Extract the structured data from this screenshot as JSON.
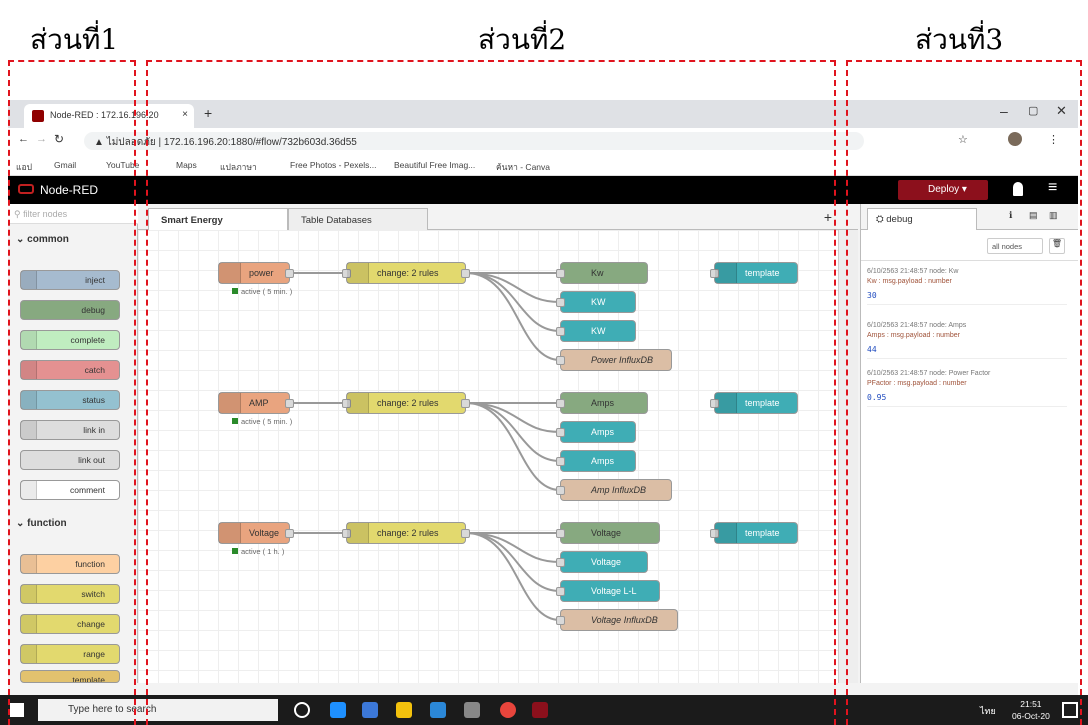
{
  "sections": {
    "s1": "ส่วนที่1",
    "s2": "ส่วนที่2",
    "s3": "ส่วนที่3"
  },
  "browser": {
    "tab_title": "Node-RED : 172.16.196.20",
    "new_tab": "+",
    "url_secure": "ไม่ปลอดภัย",
    "url": "172.16.196.20:1880/#flow/732b603d.36d55",
    "bookmarks": [
      "แอป",
      "Gmail",
      "YouTube",
      "Maps",
      "แปลภาษา",
      "Free Photos - Pexels...",
      "Beautiful Free Imag...",
      "ค้นหา - Canva"
    ]
  },
  "header": {
    "app": "Node-RED",
    "deploy": "Deploy"
  },
  "palette": {
    "filter_placeholder": "filter nodes",
    "cat_common": "common",
    "cat_function": "function",
    "common": [
      "inject",
      "debug",
      "complete",
      "catch",
      "status",
      "link in",
      "link out",
      "comment"
    ],
    "function": [
      "function",
      "switch",
      "change",
      "range",
      "template"
    ]
  },
  "workspace": {
    "tabs": [
      "Smart Energy",
      "Table Databases"
    ],
    "add": "+"
  },
  "flows": {
    "rows": [
      {
        "src": "power",
        "status": "active ( 5 min. )",
        "change": "change: 2 rules",
        "out": [
          "Kw",
          "KW",
          "KW",
          "Power InfluxDB"
        ],
        "tpl": "template"
      },
      {
        "src": "AMP",
        "status": "active ( 5 min. )",
        "change": "change: 2 rules",
        "out": [
          "Amps",
          "Amps",
          "Amps",
          "Amp InfluxDB"
        ],
        "tpl": "template"
      },
      {
        "src": "Voltage",
        "status": "active ( 1 h. )",
        "change": "change: 2 rules",
        "out": [
          "Voltage",
          "Voltage",
          "Voltage L-L",
          "Voltage InfluxDB"
        ],
        "tpl": "template"
      }
    ]
  },
  "sidebar": {
    "tab": "debug",
    "filter": "all nodes",
    "msgs": [
      {
        "meta": "6/10/2563 21:48:57   node: Kw",
        "topic": "Kw : msg.payload : number",
        "value": "30"
      },
      {
        "meta": "6/10/2563 21:48:57   node: Amps",
        "topic": "Amps : msg.payload : number",
        "value": "44"
      },
      {
        "meta": "6/10/2563 21:48:57   node: Power Factor",
        "topic": "PFactor : msg.payload : number",
        "value": "0.95"
      }
    ]
  },
  "taskbar": {
    "search": "Type here to search",
    "time": "21:51",
    "date": "06-Oct-20",
    "lang": "ไทย"
  },
  "colors": {
    "red": "#e0141e",
    "deploy": "#8c101c",
    "inject": "#a6bbcf",
    "debug": "#87a980",
    "change": "#e2d96e",
    "influx": "#dbbea5",
    "template": "#3fadb5",
    "source": "#e9a47f"
  }
}
